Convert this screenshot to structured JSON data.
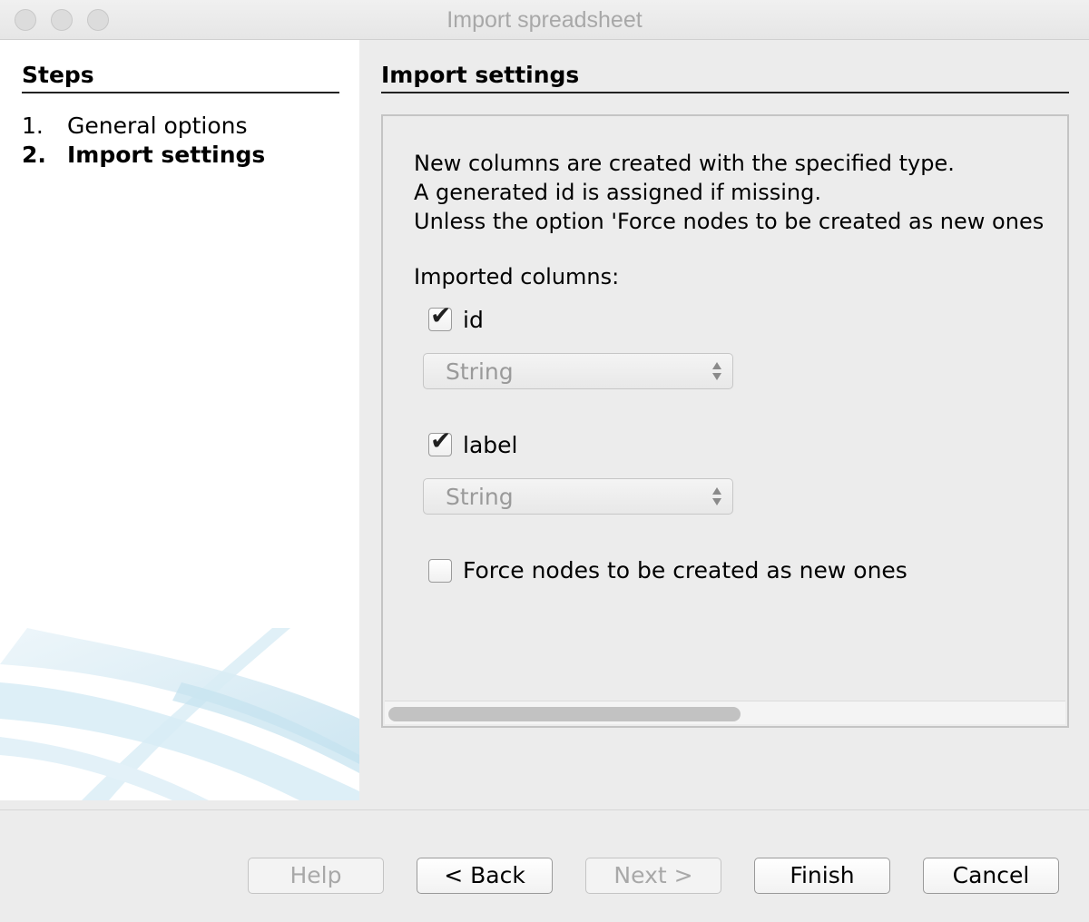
{
  "window": {
    "title": "Import spreadsheet"
  },
  "steps": {
    "heading": "Steps",
    "items": [
      {
        "number": "1.",
        "label": "General options",
        "current": false
      },
      {
        "number": "2.",
        "label": "Import settings",
        "current": true
      }
    ]
  },
  "settings": {
    "heading": "Import settings",
    "description": [
      "New columns are created with the specified type.",
      "A generated id is assigned if missing.",
      "Unless the option 'Force nodes to be created as new ones"
    ],
    "imported_columns_label": "Imported columns:",
    "columns": [
      {
        "name": "id",
        "checked": true,
        "type": "String"
      },
      {
        "name": "label",
        "checked": true,
        "type": "String"
      }
    ],
    "force_new": {
      "label": "Force nodes to be created as new ones",
      "checked": false
    },
    "scrollbar_position": 0
  },
  "buttons": {
    "help": {
      "label": "Help",
      "enabled": false
    },
    "back": {
      "label": "< Back",
      "enabled": true
    },
    "next": {
      "label": "Next >",
      "enabled": false
    },
    "finish": {
      "label": "Finish",
      "enabled": true
    },
    "cancel": {
      "label": "Cancel",
      "enabled": true
    }
  }
}
